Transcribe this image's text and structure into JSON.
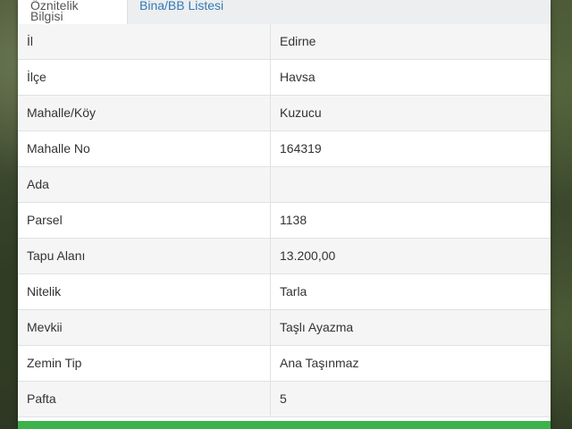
{
  "tabs": [
    {
      "label": "Öznitelik Bilgisi"
    },
    {
      "label": "Bina/BB Listesi"
    }
  ],
  "rows": [
    {
      "label": "İl",
      "value": "Edirne"
    },
    {
      "label": "İlçe",
      "value": "Havsa"
    },
    {
      "label": "Mahalle/Köy",
      "value": "Kuzucu"
    },
    {
      "label": "Mahalle No",
      "value": "164319"
    },
    {
      "label": "Ada",
      "value": ""
    },
    {
      "label": "Parsel",
      "value": "1138"
    },
    {
      "label": "Tapu Alanı",
      "value": "13.200,00"
    },
    {
      "label": "Nitelik",
      "value": "Tarla"
    },
    {
      "label": "Mevkii",
      "value": "Taşlı Ayazma"
    },
    {
      "label": "Zemin Tip",
      "value": "Ana Taşınmaz"
    },
    {
      "label": "Pafta",
      "value": "5"
    }
  ],
  "colors": {
    "tab_link": "#337ab7",
    "action_bar": "#3cb34a"
  }
}
